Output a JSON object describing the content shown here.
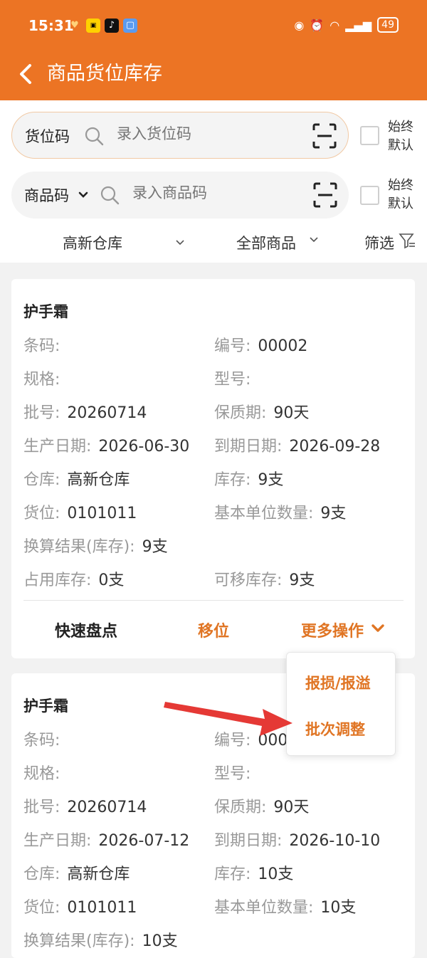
{
  "status": {
    "time": "15:31",
    "battery": "49"
  },
  "header": {
    "title": "商品货位库存"
  },
  "search1": {
    "label": "货位码",
    "placeholder": "录入货位码",
    "checkbox_label": "始终默认"
  },
  "search2": {
    "label": "商品码",
    "placeholder": "录入商品码",
    "checkbox_label": "始终默认"
  },
  "filters": {
    "warehouse": "高新仓库",
    "goods": "全部商品",
    "filter": "筛选"
  },
  "cards": [
    {
      "name": "护手霜",
      "fields": [
        {
          "label": "条码:",
          "value": ""
        },
        {
          "label": "编号:",
          "value": "00002"
        },
        {
          "label": "规格:",
          "value": ""
        },
        {
          "label": "型号:",
          "value": ""
        },
        {
          "label": "批号:",
          "value": "20260714"
        },
        {
          "label": "保质期:",
          "value": "90天"
        },
        {
          "label": "生产日期:",
          "value": "2026-06-30"
        },
        {
          "label": "到期日期:",
          "value": "2026-09-28"
        },
        {
          "label": "仓库:",
          "value": "高新仓库"
        },
        {
          "label": "库存:",
          "value": "9支"
        },
        {
          "label": "货位:",
          "value": "0101011"
        },
        {
          "label": "基本单位数量:",
          "value": "9支"
        },
        {
          "label": "换算结果(库存):",
          "value": "9支"
        },
        {
          "label": "占用库存:",
          "value": "0支"
        },
        {
          "label": "可移库存:",
          "value": "9支"
        }
      ],
      "actions": {
        "quick_count": "快速盘点",
        "move": "移位",
        "more": "更多操作"
      }
    },
    {
      "name": "护手霜",
      "fields": [
        {
          "label": "条码:",
          "value": ""
        },
        {
          "label": "编号:",
          "value": "000"
        },
        {
          "label": "规格:",
          "value": ""
        },
        {
          "label": "型号:",
          "value": ""
        },
        {
          "label": "批号:",
          "value": "20260714"
        },
        {
          "label": "保质期:",
          "value": "90天"
        },
        {
          "label": "生产日期:",
          "value": "2026-07-12"
        },
        {
          "label": "到期日期:",
          "value": "2026-10-10"
        },
        {
          "label": "仓库:",
          "value": "高新仓库"
        },
        {
          "label": "库存:",
          "value": "10支"
        },
        {
          "label": "货位:",
          "value": "0101011"
        },
        {
          "label": "基本单位数量:",
          "value": "10支"
        },
        {
          "label": "换算结果(库存):",
          "value": "10支"
        }
      ]
    }
  ],
  "dropdown": {
    "items": [
      "报损/报溢",
      "批次调整"
    ]
  },
  "colors": {
    "header": "#ec7424",
    "accent": "#e07524",
    "arrow": "#e53935"
  }
}
